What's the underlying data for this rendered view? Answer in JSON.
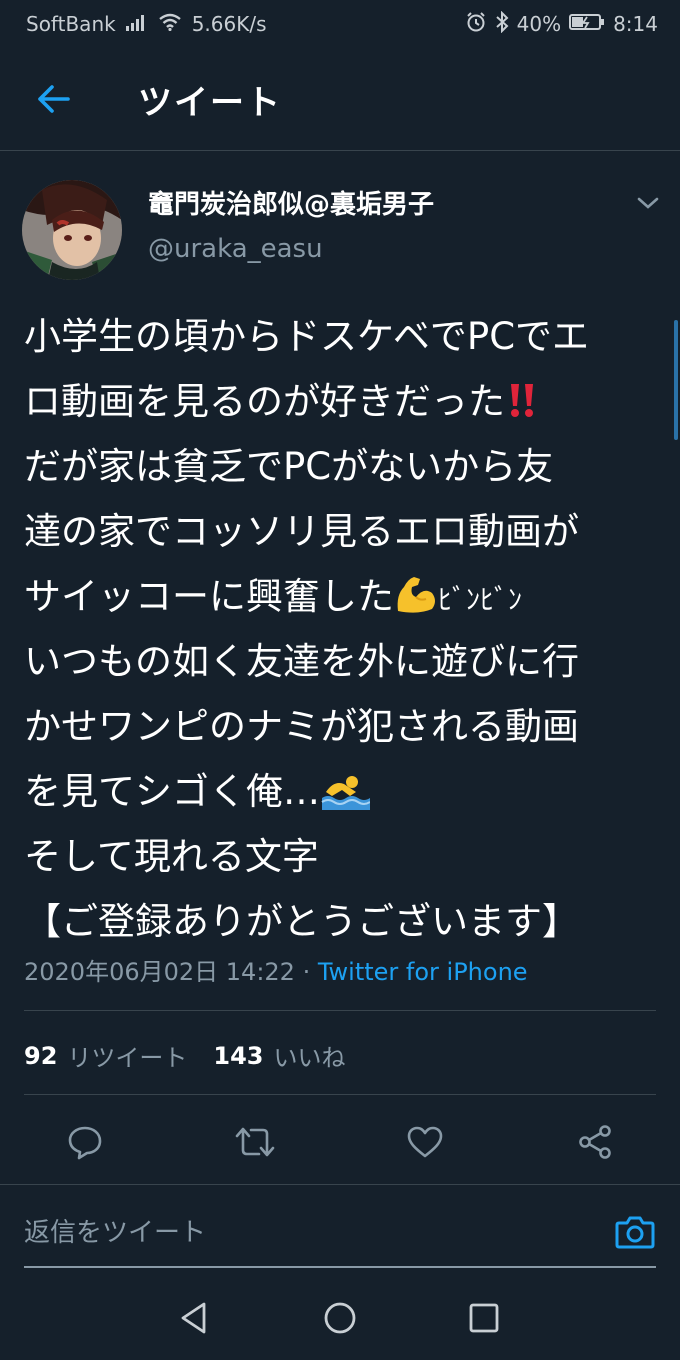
{
  "status_bar": {
    "carrier": "SoftBank",
    "speed": "5.66K/s",
    "battery": "40%",
    "time": "8:14"
  },
  "header": {
    "title": "ツイート"
  },
  "tweet": {
    "display_name": "竈門炭治郎似@裏垢男子",
    "handle": "@uraka_easu",
    "lines": [
      "小学生の頃からドスケベでPCでエ",
      "ロ動画を見るのが好きだった",
      "だが家は貧乏でPCがないから友",
      "達の家でコッソリ見るエロ動画が",
      "サイッコーに興奮した",
      "いつもの如く友達を外に遊びに行",
      "かせワンピのナミが犯される動画",
      "を見てシゴく俺…",
      "そして現れる文字",
      "【ご登録ありがとうございます】"
    ],
    "line5_suffix": "ﾋﾞﾝﾋﾞﾝ",
    "emoji": [
      "double-exclamation-icon",
      "flexed-biceps-icon",
      "person-swimming-icon"
    ],
    "timestamp": "2020年06月02日 14:22 · ",
    "source": "Twitter for iPhone",
    "retweet_count": "92",
    "retweet_label": "リツイート",
    "like_count": "143",
    "like_label": "いいね"
  },
  "reply": {
    "placeholder": "返信をツイート"
  },
  "colors": {
    "background": "#15202b",
    "accent": "#1da1f2",
    "secondary_text": "#8899a6",
    "divider": "#38444d"
  }
}
